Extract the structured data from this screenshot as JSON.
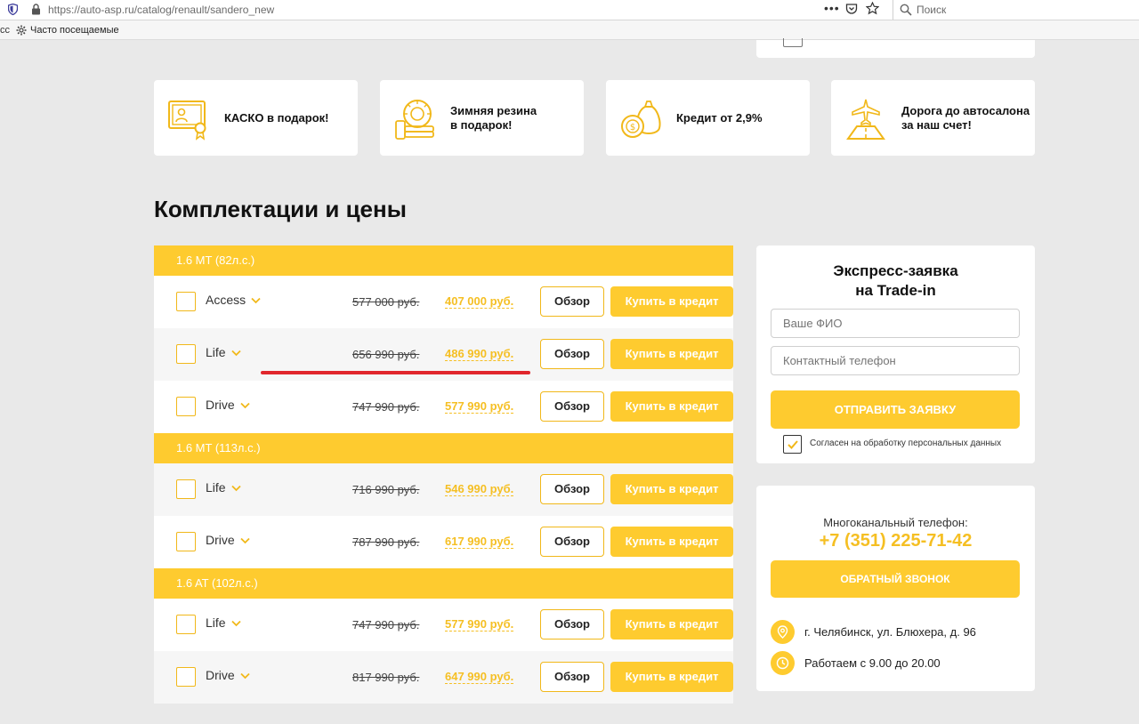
{
  "browser": {
    "url": "https://auto-asp.ru/catalog/renault/sandero_new",
    "menu_dots": "•••",
    "search_placeholder": "Поиск",
    "bookmark_edge": "сс",
    "bookmark_label": "Часто посещаемые"
  },
  "features": [
    {
      "icon": "certificate-icon",
      "text": "КАСКО в подарок!"
    },
    {
      "icon": "tire-icon",
      "text": "Зимняя резина\nв подарок!"
    },
    {
      "icon": "money-bag-icon",
      "text": "Кредит от 2,9%"
    },
    {
      "icon": "airplane-road-icon",
      "text": "Дорога до автосалона\nза наш счет!"
    }
  ],
  "section_title": "Комплектации и цены",
  "button_labels": {
    "overview": "Обзор",
    "credit": "Купить в кредит"
  },
  "groups": [
    {
      "name": "1.6 MT (82л.с.)",
      "rows": [
        {
          "trim": "Access",
          "old_price": "577 000 руб.",
          "new_price": "407 000 руб."
        },
        {
          "trim": "Life",
          "old_price": "656 990 руб.",
          "new_price": "486 990 руб."
        },
        {
          "trim": "Drive",
          "old_price": "747 990 руб.",
          "new_price": "577 990 руб."
        }
      ]
    },
    {
      "name": "1.6 MT (113л.с.)",
      "rows": [
        {
          "trim": "Life",
          "old_price": "716 990 руб.",
          "new_price": "546 990 руб."
        },
        {
          "trim": "Drive",
          "old_price": "787 990 руб.",
          "new_price": "617 990 руб."
        }
      ]
    },
    {
      "name": "1.6 AT (102л.с.)",
      "rows": [
        {
          "trim": "Life",
          "old_price": "747 990 руб.",
          "new_price": "577 990 руб."
        },
        {
          "trim": "Drive",
          "old_price": "817 990 руб.",
          "new_price": "647 990 руб."
        }
      ]
    }
  ],
  "tradein_form": {
    "title_line1": "Экспресс-заявка",
    "title_line2": "на Trade-in",
    "name_placeholder": "Ваше ФИО",
    "phone_placeholder": "Контактный телефон",
    "submit_label": "ОТПРАВИТЬ ЗАЯВКУ",
    "consent_label": "Согласен на обработку персональных данных",
    "consent_checked": true
  },
  "contacts": {
    "phone_label": "Многоканальный телефон:",
    "phone": "+7 (351) 225-71-42",
    "callback_label": "ОБРАТНЫЙ ЗВОНОК",
    "address": "г. Челябинск, ул. Блюхера, д. 96",
    "hours": "Работаем с 9.00 до 20.00"
  },
  "colors": {
    "accent": "#fecb2f",
    "price_accent": "#f5bf23",
    "annotation_red": "#e0262c"
  }
}
